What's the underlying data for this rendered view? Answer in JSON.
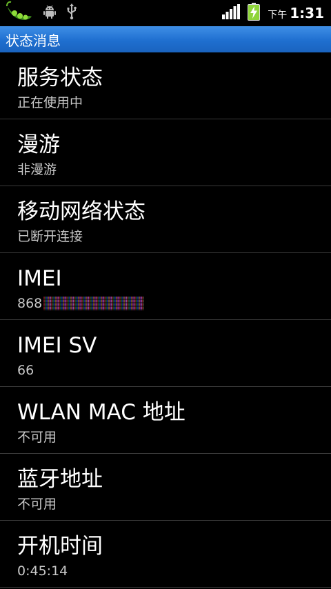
{
  "status_bar": {
    "ampm": "下午",
    "time": "1:31",
    "icons": [
      "peapod-icon",
      "android-debug-icon",
      "usb-icon",
      "signal-icon",
      "battery-charging-icon"
    ]
  },
  "header": {
    "title": "状态消息"
  },
  "items": [
    {
      "title": "服务状态",
      "value": "正在使用中"
    },
    {
      "title": "漫游",
      "value": "非漫游"
    },
    {
      "title": "移动网络状态",
      "value": "已断开连接"
    },
    {
      "title": "IMEI",
      "value": "868"
    },
    {
      "title": "IMEI SV",
      "value": "66"
    },
    {
      "title": "WLAN MAC 地址",
      "value": "不可用"
    },
    {
      "title": "蓝牙地址",
      "value": "不可用"
    },
    {
      "title": "开机时间",
      "value": "0:45:14"
    }
  ],
  "colors": {
    "header_top": "#3f8fe6",
    "header_bottom": "#1a63bf",
    "battery_green": "#8ed43a"
  }
}
